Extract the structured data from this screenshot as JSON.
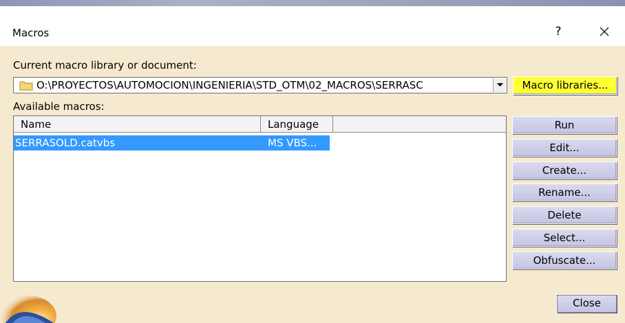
{
  "dialog": {
    "title": "Macros",
    "help_label": "?"
  },
  "library": {
    "label": "Current macro library or document:",
    "path": "O:\\PROYECTOS\\AUTOMOCION\\INGENIERIA\\STD_OTM\\02_MACROS\\SERRASC",
    "libraries_button": "Macro libraries..."
  },
  "macros": {
    "label": "Available macros:",
    "columns": [
      "Name",
      "Language"
    ],
    "rows": [
      {
        "name": "SERRASOLD.catvbs",
        "language": "MS VBS..."
      }
    ]
  },
  "buttons": {
    "run": "Run",
    "edit": "Edit...",
    "create": "Create...",
    "rename": "Rename...",
    "delete": "Delete",
    "select": "Select...",
    "obfuscate": "Obfuscate...",
    "close": "Close"
  },
  "colors": {
    "dialog_background": "#f5e9cf",
    "selection": "#3399ff",
    "button": "#c9c9e6",
    "highlight": "#ffff33"
  }
}
